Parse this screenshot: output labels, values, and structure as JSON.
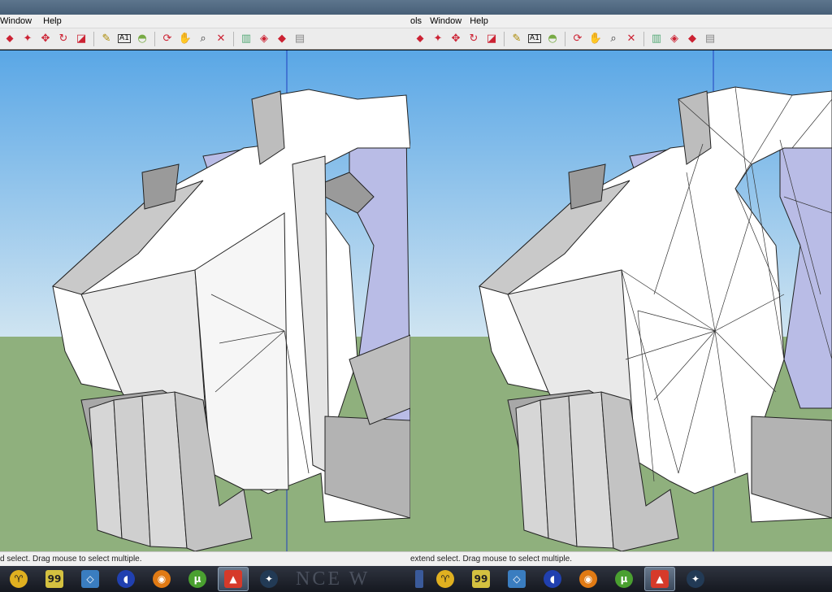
{
  "panes": [
    {
      "menu": [
        "Window",
        "Help"
      ],
      "status": "d select. Drag mouse to select multiple.",
      "taskbar_watermark": "NCE W"
    },
    {
      "menu": [
        "ols",
        "Window",
        "Help"
      ],
      "status": "extend select. Drag mouse to select multiple.",
      "taskbar_watermark": ""
    }
  ],
  "toolbar_icons": [
    "push-pull-icon",
    "follow-me-icon",
    "move-icon",
    "rotate-icon",
    "scale-icon",
    "tape-measure-icon",
    "text-icon",
    "paint-bucket-icon",
    "orbit-icon",
    "pan-icon",
    "zoom-icon",
    "zoom-extents-icon",
    "get-models-icon",
    "share-model-icon",
    "components-icon",
    "send-to-layout-icon"
  ],
  "taskbar_icons": [
    "app-icon-a",
    "app-icon-b",
    "app-icon-c",
    "audio-icon",
    "blender-icon",
    "utorrent-icon",
    "sketchup-icon",
    "network-icon"
  ],
  "colors": {
    "sky_top": "#5aa7e6",
    "sky_bottom": "#cfe4f1",
    "ground": "#8fb07d",
    "model_light": "#ffffff",
    "model_mid": "#c9c9c9",
    "model_dark": "#8d8d8d",
    "model_back": "#b9bce6",
    "axis_blue": "#1f3fbf"
  }
}
